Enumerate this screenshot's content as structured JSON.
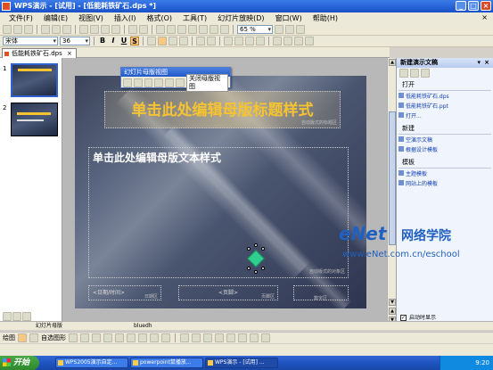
{
  "window": {
    "title": "WPS演示 - [试用] - [低能耗铁矿石.dps *]",
    "buttons": [
      "_",
      "□",
      "×"
    ]
  },
  "menubar": {
    "items": [
      "文件(F)",
      "编辑(E)",
      "视图(V)",
      "插入(I)",
      "格式(O)",
      "工具(T)",
      "幻灯片放映(D)",
      "窗口(W)",
      "帮助(H)"
    ],
    "close": "×"
  },
  "format_toolbar": {
    "font": "宋体",
    "size": "36",
    "bold": "B",
    "italic": "I",
    "underline": "U",
    "shadow": "S",
    "zoom": "65 %"
  },
  "document_tab": {
    "label": "低能耗铁矿石.dps",
    "close": "×"
  },
  "thumbnails": [
    {
      "num": "1"
    },
    {
      "num": "2"
    }
  ],
  "master_toolbar": {
    "title": "幻灯片母版视图",
    "close_label": "关闭母版视图"
  },
  "slide": {
    "title": "单击此处编辑母版标题样式",
    "title_area_label": "自动版式的标题区",
    "body": "单击此处编辑母版文本样式",
    "object_area_label": "自动版式的对象区",
    "date_area": "<日期/时间>",
    "date_label": "日期区",
    "footer_area": "<页脚>",
    "footer_label": "页脚区",
    "number_label": "数字区"
  },
  "taskpane": {
    "title": "新建演示文稿",
    "sections": [
      {
        "title": "打开",
        "items": [
          "低能耗铁矿石.dps",
          "低能耗铁矿石.ppt",
          "打开..."
        ]
      },
      {
        "title": "新建",
        "items": [
          "空演示文稿",
          "根据设计模板"
        ]
      },
      {
        "title": "模板",
        "items": [
          "主题模板",
          "网站上的模板"
        ]
      }
    ],
    "startup_label": "启动时显示"
  },
  "statusbar": {
    "mode": "幻灯片母版",
    "theme": "bluedh"
  },
  "drawbar": {
    "draw_label": "绘图",
    "autoshape_label": "自选图形"
  },
  "watermark": {
    "brand": "eNet",
    "name": "网络学院",
    "url": "www.eNet.com.cn/eschool"
  },
  "taskbar": {
    "start": "开始",
    "tasks": [
      "WPS2005演示自定...",
      "powerpoint鼠播放...",
      "WPS演示 - [试用] ..."
    ],
    "time": "9:20"
  }
}
